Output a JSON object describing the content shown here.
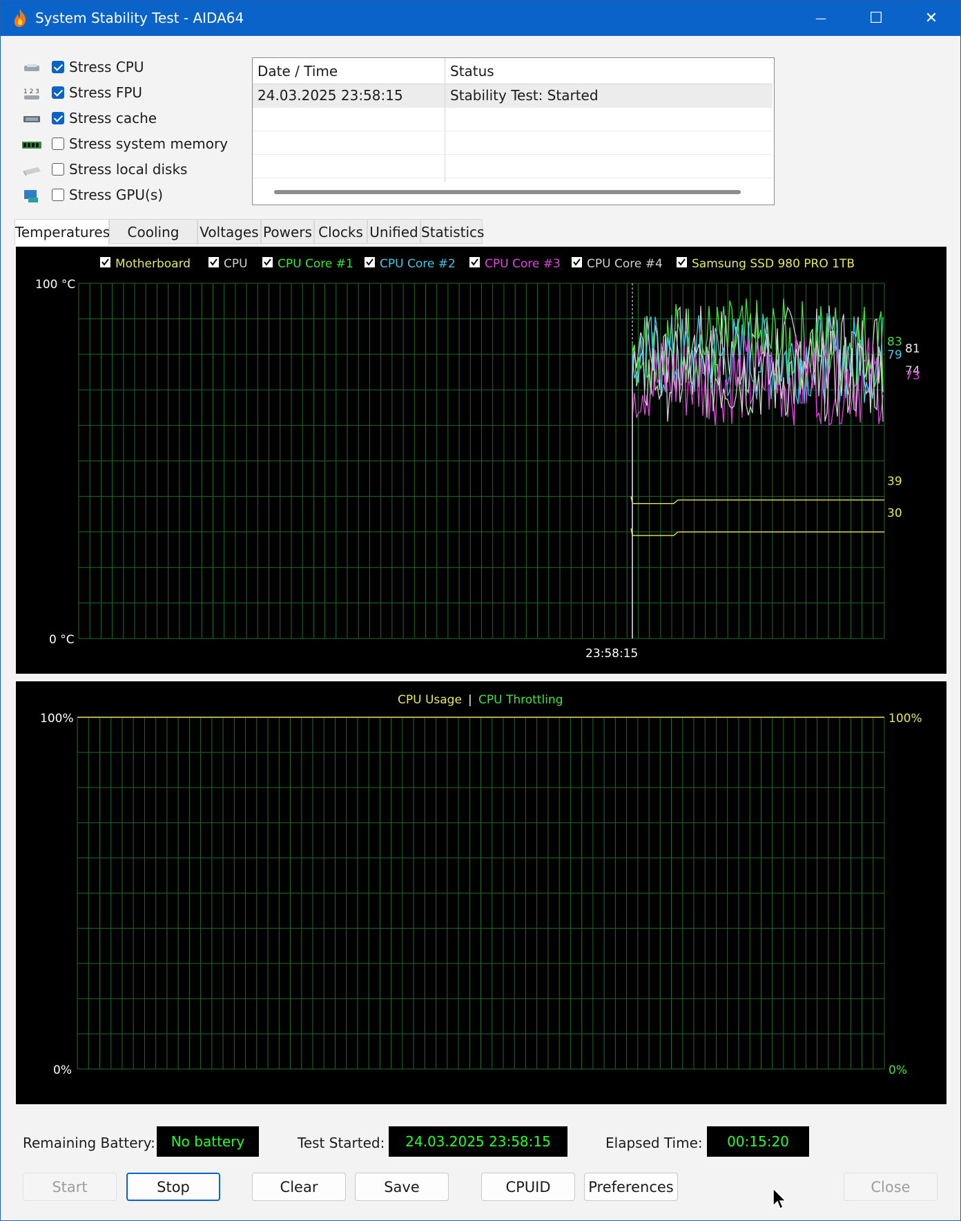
{
  "window": {
    "title": "System Stability Test - AIDA64",
    "controls": {
      "minimize": "—",
      "maximize": "☐",
      "close": "✕"
    }
  },
  "stress_options": [
    {
      "label": "Stress CPU",
      "checked": true,
      "icon": "cpu-chip-icon"
    },
    {
      "label": "Stress FPU",
      "checked": true,
      "icon": "fpu-123-icon"
    },
    {
      "label": "Stress cache",
      "checked": true,
      "icon": "cache-chip-icon"
    },
    {
      "label": "Stress system memory",
      "checked": false,
      "icon": "memory-module-icon"
    },
    {
      "label": "Stress local disks",
      "checked": false,
      "icon": "disk-drive-icon"
    },
    {
      "label": "Stress GPU(s)",
      "checked": false,
      "icon": "gpu-monitor-icon"
    }
  ],
  "log": {
    "columns": [
      "Date / Time",
      "Status"
    ],
    "rows": [
      {
        "datetime": "24.03.2025 23:58:15",
        "status": "Stability Test: Started"
      }
    ]
  },
  "tabs": [
    "Temperatures",
    "Cooling Fans",
    "Voltages",
    "Powers",
    "Clocks",
    "Unified",
    "Statistics"
  ],
  "active_tab": "Temperatures",
  "temperature_chart": {
    "legend": [
      {
        "label": "Motherboard",
        "color": "#e8e85a",
        "checked": true
      },
      {
        "label": "CPU",
        "color": "#d0d0d0",
        "checked": true
      },
      {
        "label": "CPU Core #1",
        "color": "#39e639",
        "checked": true
      },
      {
        "label": "CPU Core #2",
        "color": "#3cc8e8",
        "checked": true
      },
      {
        "label": "CPU Core #3",
        "color": "#e040e0",
        "checked": true
      },
      {
        "label": "CPU Core #4",
        "color": "#d0d0d0",
        "checked": true
      },
      {
        "label": "Samsung SSD 980 PRO 1TB",
        "color": "#e8e85a",
        "checked": true
      }
    ],
    "y_max_label": "100 °C",
    "y_min_label": "0 °C",
    "x_label": "23:58:15",
    "value_labels": [
      {
        "text": "83",
        "color": "#39e639"
      },
      {
        "text": "81",
        "color": "#f0f0f0"
      },
      {
        "text": "79",
        "color": "#3cc8e8"
      },
      {
        "text": "74",
        "color": "#d0d0d0"
      },
      {
        "text": "73",
        "color": "#e040e0"
      },
      {
        "text": "39",
        "color": "#e8e85a"
      },
      {
        "text": "30",
        "color": "#e8e85a"
      }
    ]
  },
  "usage_chart": {
    "title_usage": "CPU Usage",
    "separator": "|",
    "title_throttling": "CPU Throttling",
    "usage_color": "#e8e85a",
    "throttling_color": "#39e639",
    "left_max": "100%",
    "left_min": "0%",
    "right_max": "100%",
    "right_min": "0%"
  },
  "chart_data": [
    {
      "type": "line",
      "ylim": [
        0,
        100
      ],
      "x": [
        "23:58:15"
      ],
      "series": [
        {
          "name": "Motherboard",
          "values": [
            39
          ]
        },
        {
          "name": "CPU",
          "values": [
            81
          ]
        },
        {
          "name": "CPU Core #1",
          "values": [
            83
          ]
        },
        {
          "name": "CPU Core #2",
          "values": [
            79
          ]
        },
        {
          "name": "CPU Core #3",
          "values": [
            73
          ]
        },
        {
          "name": "CPU Core #4",
          "values": [
            74
          ]
        },
        {
          "name": "Samsung SSD 980 PRO 1TB",
          "values": [
            30
          ]
        }
      ]
    },
    {
      "type": "line",
      "ylim": [
        0,
        100
      ],
      "series": [
        {
          "name": "CPU Usage",
          "values": []
        },
        {
          "name": "CPU Throttling",
          "values": []
        }
      ]
    }
  ],
  "status": {
    "battery_label": "Remaining Battery:",
    "battery_value": "No battery",
    "started_label": "Test Started:",
    "started_value": "24.03.2025 23:58:15",
    "elapsed_label": "Elapsed Time:",
    "elapsed_value": "00:15:20"
  },
  "buttons": {
    "start": "Start",
    "stop": "Stop",
    "clear": "Clear",
    "save": "Save",
    "cpuid": "CPUID",
    "preferences": "Preferences",
    "close": "Close"
  }
}
